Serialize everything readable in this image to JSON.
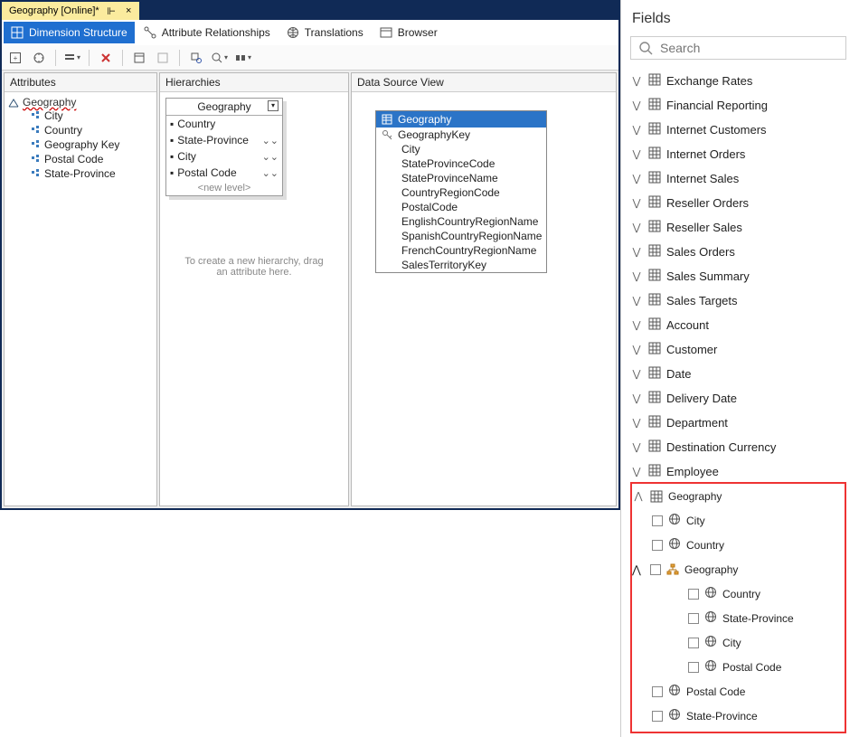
{
  "doc_tab": {
    "title": "Geography [Online]*",
    "pin": "⊩",
    "close": "×"
  },
  "inner_tabs": {
    "t0": "Dimension Structure",
    "t1": "Attribute Relationships",
    "t2": "Translations",
    "t3": "Browser"
  },
  "panes": {
    "attributes_h": "Attributes",
    "hierarchies_h": "Hierarchies",
    "dsv_h": "Data Source View"
  },
  "attributes": {
    "root": "Geography",
    "items": [
      "City",
      "Country",
      "Geography Key",
      "Postal Code",
      "State-Province"
    ]
  },
  "hierarchy_card": {
    "title": "Geography",
    "levels": [
      "Country",
      "State-Province",
      "City",
      "Postal Code"
    ],
    "new_level": "<new level>"
  },
  "hier_hint": "To create a new hierarchy, drag an attribute here.",
  "dsv_table": {
    "title": "Geography",
    "key": "GeographyKey",
    "cols": [
      "City",
      "StateProvinceCode",
      "StateProvinceName",
      "CountryRegionCode",
      "PostalCode",
      "EnglishCountryRegionName",
      "SpanishCountryRegionName",
      "FrenchCountryRegionName",
      "SalesTerritoryKey"
    ]
  },
  "fields": {
    "title": "Fields",
    "search_placeholder": "Search",
    "tables": [
      "Exchange Rates",
      "Financial Reporting",
      "Internet Customers",
      "Internet Orders",
      "Internet Sales",
      "Reseller Orders",
      "Reseller Sales",
      "Sales Orders",
      "Sales Summary",
      "Sales Targets",
      "Account",
      "Customer",
      "Date",
      "Delivery Date",
      "Department",
      "Destination Currency",
      "Employee"
    ],
    "geo": {
      "label": "Geography",
      "flat": [
        "City",
        "Country"
      ],
      "hier": {
        "label": "Geography",
        "kids": [
          "Country",
          "State-Province",
          "City",
          "Postal Code"
        ]
      },
      "tail": [
        "Postal Code",
        "State-Province"
      ]
    }
  }
}
